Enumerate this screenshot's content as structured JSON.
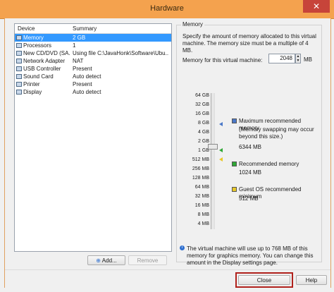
{
  "window": {
    "title": "Hardware",
    "close_glyph": "✕"
  },
  "device_list": {
    "headers": {
      "device": "Device",
      "summary": "Summary"
    },
    "rows": [
      {
        "device": "Memory",
        "summary": "2 GB"
      },
      {
        "device": "Processors",
        "summary": "1"
      },
      {
        "device": "New CD/DVD (SA...",
        "summary": "Using file C:\\JavaHonk\\Software\\Ubu..."
      },
      {
        "device": "Network Adapter",
        "summary": "NAT"
      },
      {
        "device": "USB Controller",
        "summary": "Present"
      },
      {
        "device": "Sound Card",
        "summary": "Auto detect"
      },
      {
        "device": "Printer",
        "summary": "Present"
      },
      {
        "device": "Display",
        "summary": "Auto detect"
      }
    ]
  },
  "memory": {
    "group_title": "Memory",
    "description": "Specify the amount of memory allocated to this virtual machine. The memory size must be a multiple of 4 MB.",
    "field_label": "Memory for this virtual machine:",
    "field_value": "2048",
    "unit": "MB",
    "scale": [
      "64 GB",
      "32 GB",
      "16 GB",
      "8 GB",
      "4 GB",
      "2 GB",
      "1 GB",
      "512 MB",
      "256 MB",
      "128 MB",
      "64 MB",
      "32 MB",
      "16 MB",
      "8 MB",
      "4 MB"
    ],
    "legend": {
      "max_title": "Maximum recommended memory",
      "max_note": "(Memory swapping may occur beyond this size.)",
      "max_value": "6344 MB",
      "rec_title": "Recommended memory",
      "rec_value": "1024 MB",
      "min_title": "Guest OS recommended minimum",
      "min_value": "512 MB"
    },
    "info": "The virtual machine will use up to 768 MB of this memory for graphics memory. You can change this amount in the Display settings page."
  },
  "buttons": {
    "add": "Add...",
    "remove": "Remove",
    "close": "Close",
    "help": "Help"
  },
  "colors": {
    "max_marker": "#4a78c8",
    "rec_marker": "#2fa836",
    "min_marker": "#e8c828",
    "selection": "#3399ff"
  }
}
